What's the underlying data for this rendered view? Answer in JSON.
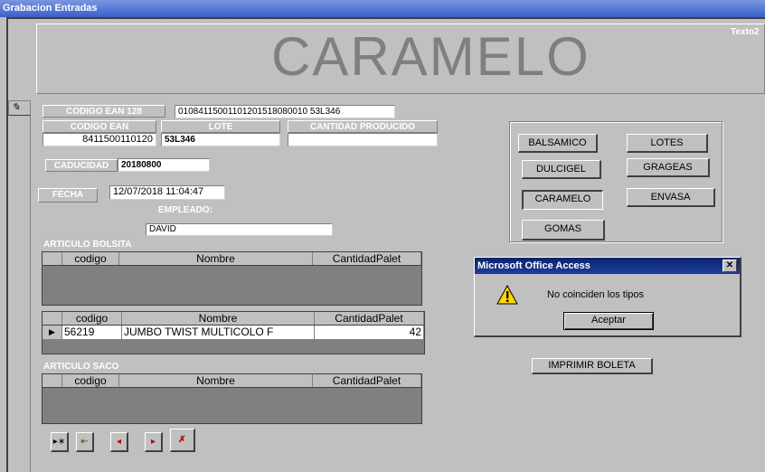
{
  "window": {
    "title": "Grabacion Entradas"
  },
  "header": {
    "big_title": "CARAMELO",
    "corner_label": "Texto2"
  },
  "form": {
    "ean128_label": "CODIGO EAN 128",
    "ean128_value": "01084115001101201518080010 53L346",
    "ean_label": "CODIGO EAN",
    "ean_value": "8411500110120",
    "lote_label": "LOTE",
    "lote_value": "53L346",
    "cantidad_label": "CANTIDAD PRODUCIDO",
    "cantidad_value": "",
    "caducidad_label": "CADUCIDAD",
    "caducidad_value": "20180800",
    "fecha_label": "FECHA",
    "fecha_value": "12/07/2018 11:04:47",
    "empleado_label": "EMPLEADO:",
    "empleado_value": "DAVID"
  },
  "bolsita": {
    "section_label": "ARTICULO BOLSITA",
    "columns": [
      "codigo",
      "Nombre",
      "CantidadPalet"
    ]
  },
  "detail": {
    "columns": [
      "codigo",
      "Nombre",
      "CantidadPalet"
    ],
    "rows": [
      {
        "codigo": "56219",
        "nombre": "JUMBO TWIST MULTICOLO F",
        "cantidad": "42"
      }
    ]
  },
  "saco": {
    "section_label": "ARTICULO SACO",
    "columns": [
      "codigo",
      "Nombre",
      "CantidadPalet"
    ]
  },
  "navigation": {
    "new_record": "▸∗",
    "exit": "⇤",
    "prev": "◂",
    "next": "▸",
    "delete": "✗"
  },
  "type_buttons": {
    "balsamico": "BALSAMICO",
    "lotes": "LOTES",
    "dulcigel": "DULCIGEL",
    "grageas": "GRAGEAS",
    "caramelo": "CARAMELO",
    "envasa": "ENVASA",
    "gomas": "GOMAS"
  },
  "print_button": "IMPRIMIR BOLETA",
  "dialog": {
    "title": "Microsoft Office Access",
    "message": "No coinciden los tipos",
    "ok_label": "Aceptar",
    "close_glyph": "✕"
  },
  "colors": {
    "titlebar": "#3a5fcd",
    "dialog_titlebar": "#0a246a",
    "background": "#c0c0c0",
    "big_title": "#7f7f7f"
  }
}
